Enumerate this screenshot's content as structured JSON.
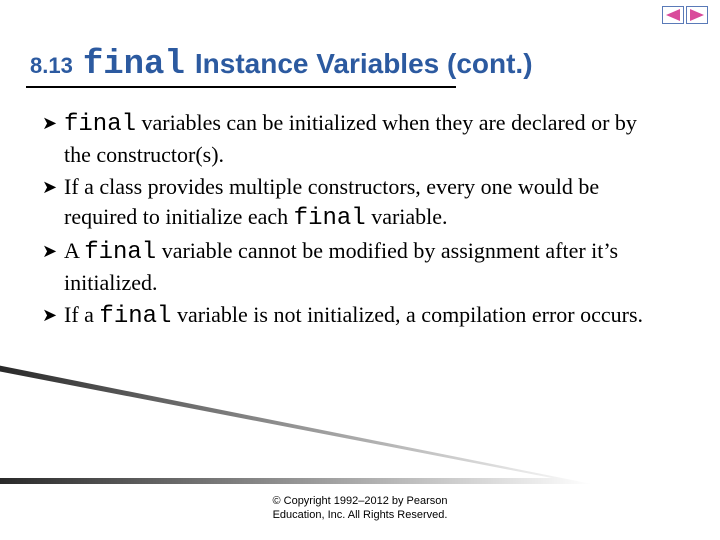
{
  "title": {
    "num": "8.13",
    "keyword": "final",
    "rest": "Instance Variables (cont.)"
  },
  "bullets": [
    {
      "pre": "",
      "mono": "final",
      "post": " variables can be initialized when they are declared or by the constructor(s)."
    },
    {
      "pre": "If a class provides multiple constructors, every one would be required to initialize each ",
      "mono": "final",
      "post": " variable."
    },
    {
      "pre": "A ",
      "mono": "final",
      "post": " variable cannot be modified by assignment after it’s initialized."
    },
    {
      "pre": "If a ",
      "mono": "final",
      "post": " variable is not initialized, a compilation error occurs."
    }
  ],
  "copyright": {
    "line1": "© Copyright 1992–2012 by Pearson",
    "line2": "Education, Inc. All Rights Reserved."
  },
  "colors": {
    "title": "#2c5aa0",
    "nav_arrow": "#d94b9b"
  }
}
